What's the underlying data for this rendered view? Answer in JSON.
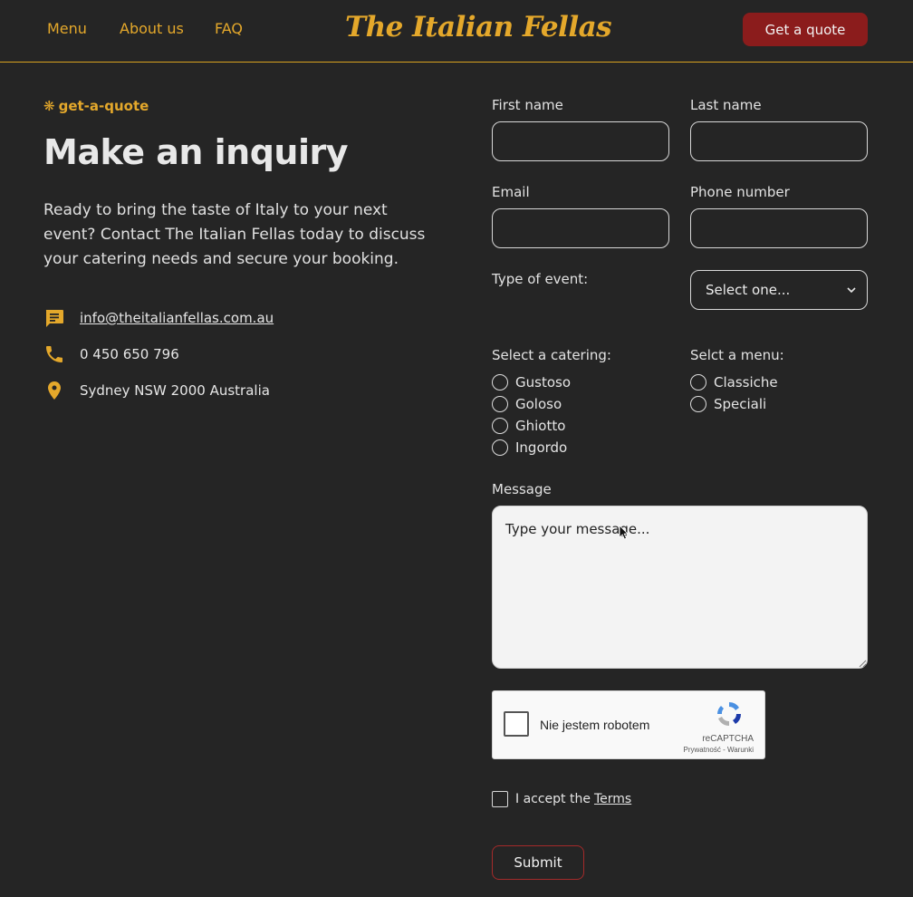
{
  "nav": {
    "links": [
      "Menu",
      "About us",
      "FAQ"
    ],
    "logo": "The Italian Fellas",
    "cta": "Get a quote"
  },
  "intro": {
    "eyebrow_icon": "❋",
    "eyebrow": "get-a-quote",
    "title": "Make an inquiry",
    "body": "Ready to bring the taste of Italy to your next event? Contact The Italian Fellas today to discuss your catering needs and secure your booking."
  },
  "contact": {
    "email": "info@theitalianfellas.com.au",
    "phone": "0 450 650 796",
    "address": "Sydney NSW 2000 Australia"
  },
  "form": {
    "first_name_label": "First name",
    "last_name_label": "Last name",
    "email_label": "Email",
    "phone_label": "Phone number",
    "event_type_label": "Type of event:",
    "event_type_selected": "Select one...",
    "catering_label": "Select a catering:",
    "catering_options": [
      "Gustoso",
      "Goloso",
      "Ghiotto",
      "Ingordo"
    ],
    "menu_label": "Selct a menu:",
    "menu_options": [
      "Classiche",
      "Speciali"
    ],
    "message_label": "Message",
    "message_placeholder": "Type your message...",
    "terms_prefix": "I accept the",
    "terms_link": "Terms",
    "submit": "Submit"
  },
  "captcha": {
    "label": "Nie jestem robotem",
    "brand": "reCAPTCHA",
    "links": "Prywatność - Warunki"
  },
  "colors": {
    "background": "#252525",
    "accent": "#e4a82b",
    "cta": "#8b1c1c"
  }
}
